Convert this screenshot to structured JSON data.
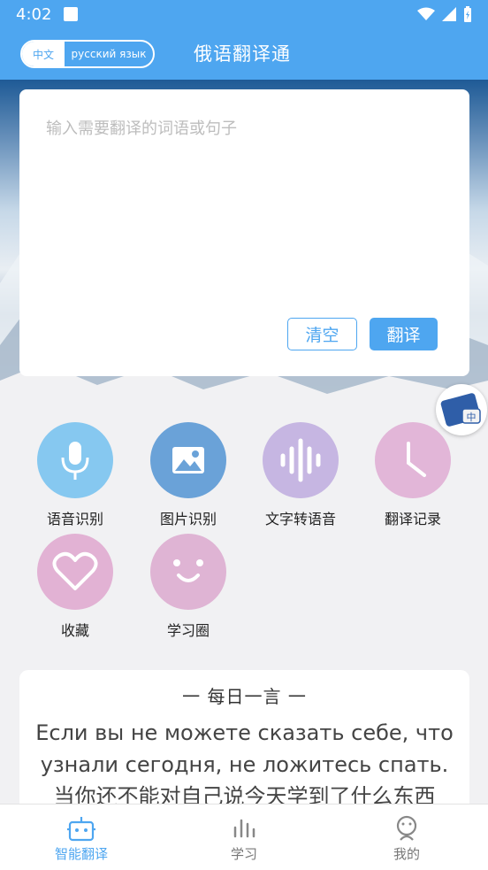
{
  "status_bar": {
    "time": "4:02"
  },
  "header": {
    "title": "俄语翻译通",
    "lang_source": "中文",
    "lang_target": "русский язык"
  },
  "input": {
    "placeholder": "输入需要翻译的词语或句子",
    "value": ""
  },
  "buttons": {
    "clear": "清空",
    "translate": "翻译"
  },
  "features": [
    {
      "label": "语音识别",
      "icon": "microphone-icon",
      "color": "#86c8f0"
    },
    {
      "label": "图片识别",
      "icon": "image-icon",
      "color": "#6aa2d8"
    },
    {
      "label": "文字转语音",
      "icon": "waveform-icon",
      "color": "#c6b6e2"
    },
    {
      "label": "翻译记录",
      "icon": "clock-icon",
      "color": "#e2b6d8"
    },
    {
      "label": "收藏",
      "icon": "heart-icon",
      "color": "#e2b2d4"
    },
    {
      "label": "学习圈",
      "icon": "smiley-icon",
      "color": "#dfb4d4"
    }
  ],
  "daily_quote": {
    "heading": "一  每日一言  一",
    "russian": "Если вы не можете сказать себе, что узнали сегодня, не ложитесь спать.",
    "chinese": "当你还不能对自己说今天学到了什么东西"
  },
  "bottom_nav": [
    {
      "label": "智能翻译",
      "icon": "robot-icon",
      "active": true
    },
    {
      "label": "学习",
      "icon": "bars-icon",
      "active": false
    },
    {
      "label": "我的",
      "icon": "person-icon",
      "active": false
    }
  ],
  "colors": {
    "primary": "#4ea6f0",
    "background": "#f1f1f3"
  }
}
